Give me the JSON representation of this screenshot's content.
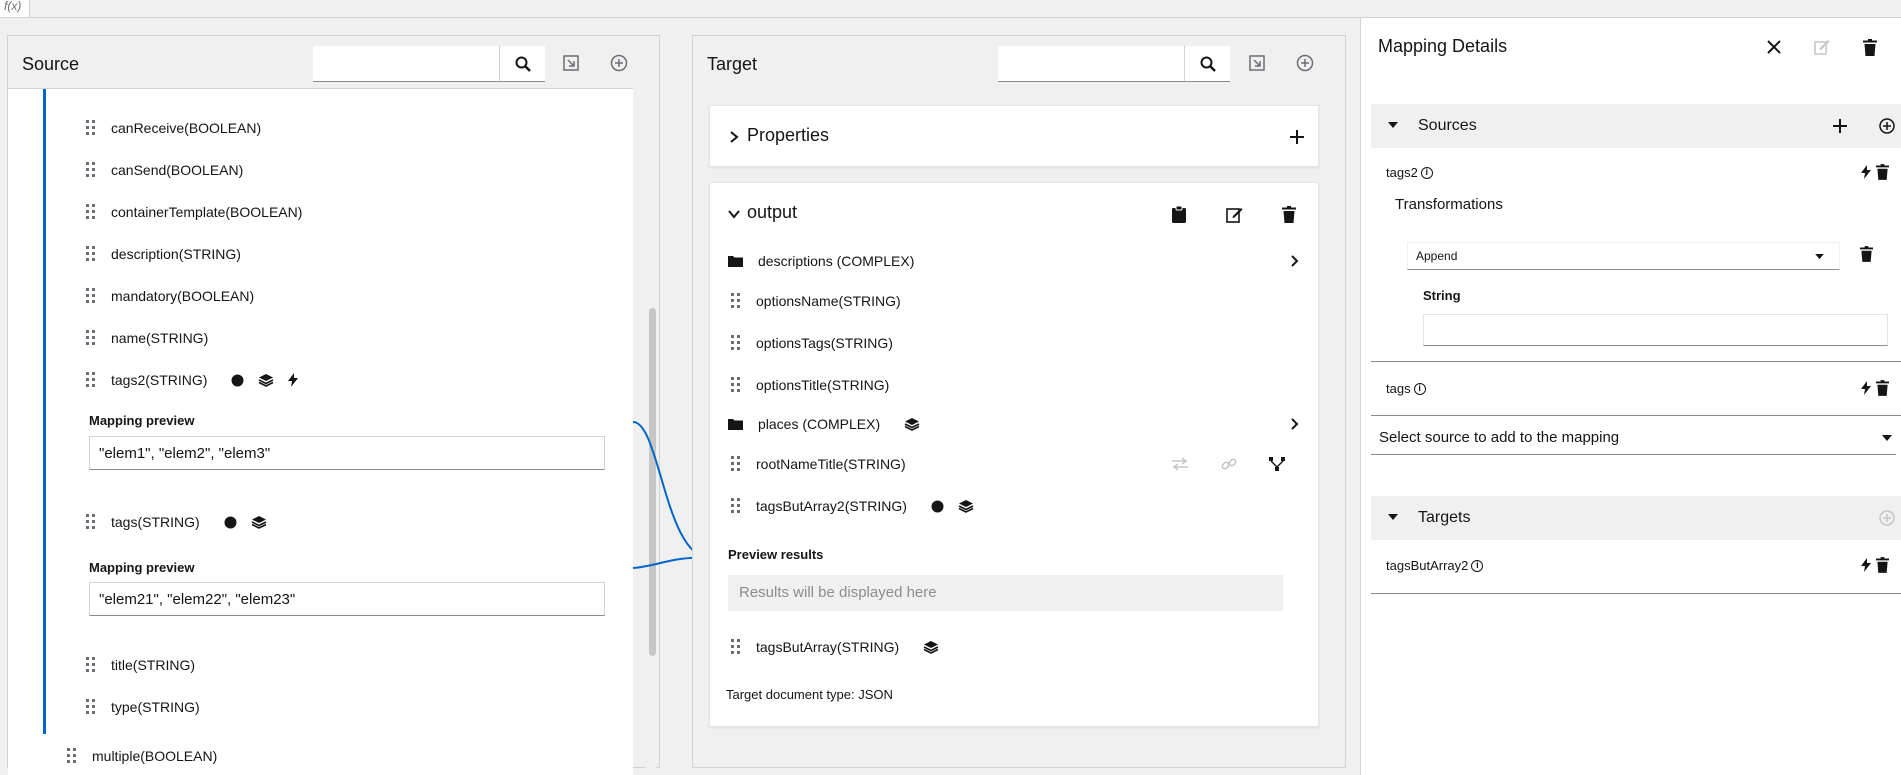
{
  "top": {
    "fx_label": "f(x)"
  },
  "source": {
    "title": "Source",
    "search_placeholder": "",
    "fields": [
      {
        "label": "canReceive(BOOLEAN)"
      },
      {
        "label": "canSend(BOOLEAN)"
      },
      {
        "label": "containerTemplate(BOOLEAN)"
      },
      {
        "label": "description(STRING)"
      },
      {
        "label": "mandatory(BOOLEAN)"
      },
      {
        "label": "name(STRING)"
      },
      {
        "label": "tags2(STRING)"
      }
    ],
    "preview_label": "Mapping preview",
    "preview1_value": "\"elem1\", \"elem2\", \"elem3\"",
    "tags_field": "tags(STRING)",
    "preview2_value": "\"elem21\", \"elem22\", \"elem23\"",
    "title_field": "title(STRING)",
    "type_field": "type(STRING)",
    "multiple_field": "multiple(BOOLEAN)"
  },
  "target": {
    "title": "Target",
    "search_placeholder": "",
    "properties_title": "Properties",
    "output_title": "output",
    "fields": {
      "descriptions": "descriptions (COMPLEX)",
      "optionsName": "optionsName(STRING)",
      "optionsTags": "optionsTags(STRING)",
      "optionsTitle": "optionsTitle(STRING)",
      "places": "places (COMPLEX)",
      "rootNameTitle": "rootNameTitle(STRING)",
      "tagsButArray2": "tagsButArray2(STRING)",
      "tagsButArray": "tagsButArray(STRING)"
    },
    "preview_results_label": "Preview results",
    "preview_results_placeholder": "Results will be displayed here",
    "doc_type": "Target document type: JSON"
  },
  "details": {
    "title": "Mapping Details",
    "sources_title": "Sources",
    "source1_name": "tags2",
    "transformations_label": "Transformations",
    "transformation_value": "Append",
    "string_label": "String",
    "string_value": "",
    "source2_name": "tags",
    "select_source_placeholder": "Select source to add to the mapping",
    "targets_title": "Targets",
    "target1_name": "tagsButArray2"
  },
  "colors": {
    "accent": "#0066cc",
    "mapping_line": "#0066cc",
    "panel_bg": "#f0f0f0"
  }
}
